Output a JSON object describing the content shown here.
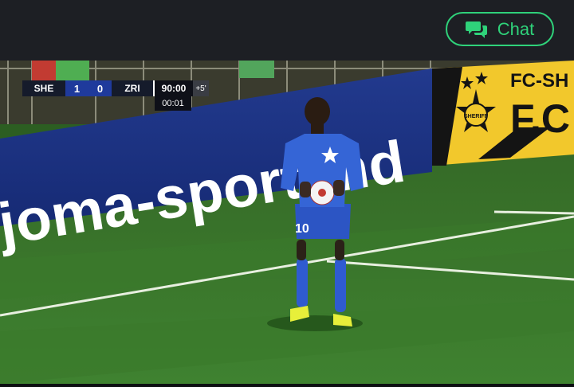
{
  "chat": {
    "label": "Chat"
  },
  "scoreboard": {
    "home_team": "SHE",
    "home_score": "1",
    "away_score": "0",
    "away_team": "ZRI",
    "match_time": "90:00",
    "added_time": "+5'",
    "stoppage_time": "00:01"
  },
  "pitch_ads": {
    "sponsor_text": "joma-sport.md",
    "club_banner_top": "FC-SH",
    "club_banner_bottom": "F.C",
    "crest_text": "SHERIFF"
  },
  "player": {
    "shirt_number": "10"
  },
  "colors": {
    "chat_accent": "#2fd27a",
    "score_blue": "#1f3a9c",
    "banner_navy": "#1a2f86",
    "banner_yellow": "#f2c82c",
    "grass": "#3f7a2d"
  }
}
